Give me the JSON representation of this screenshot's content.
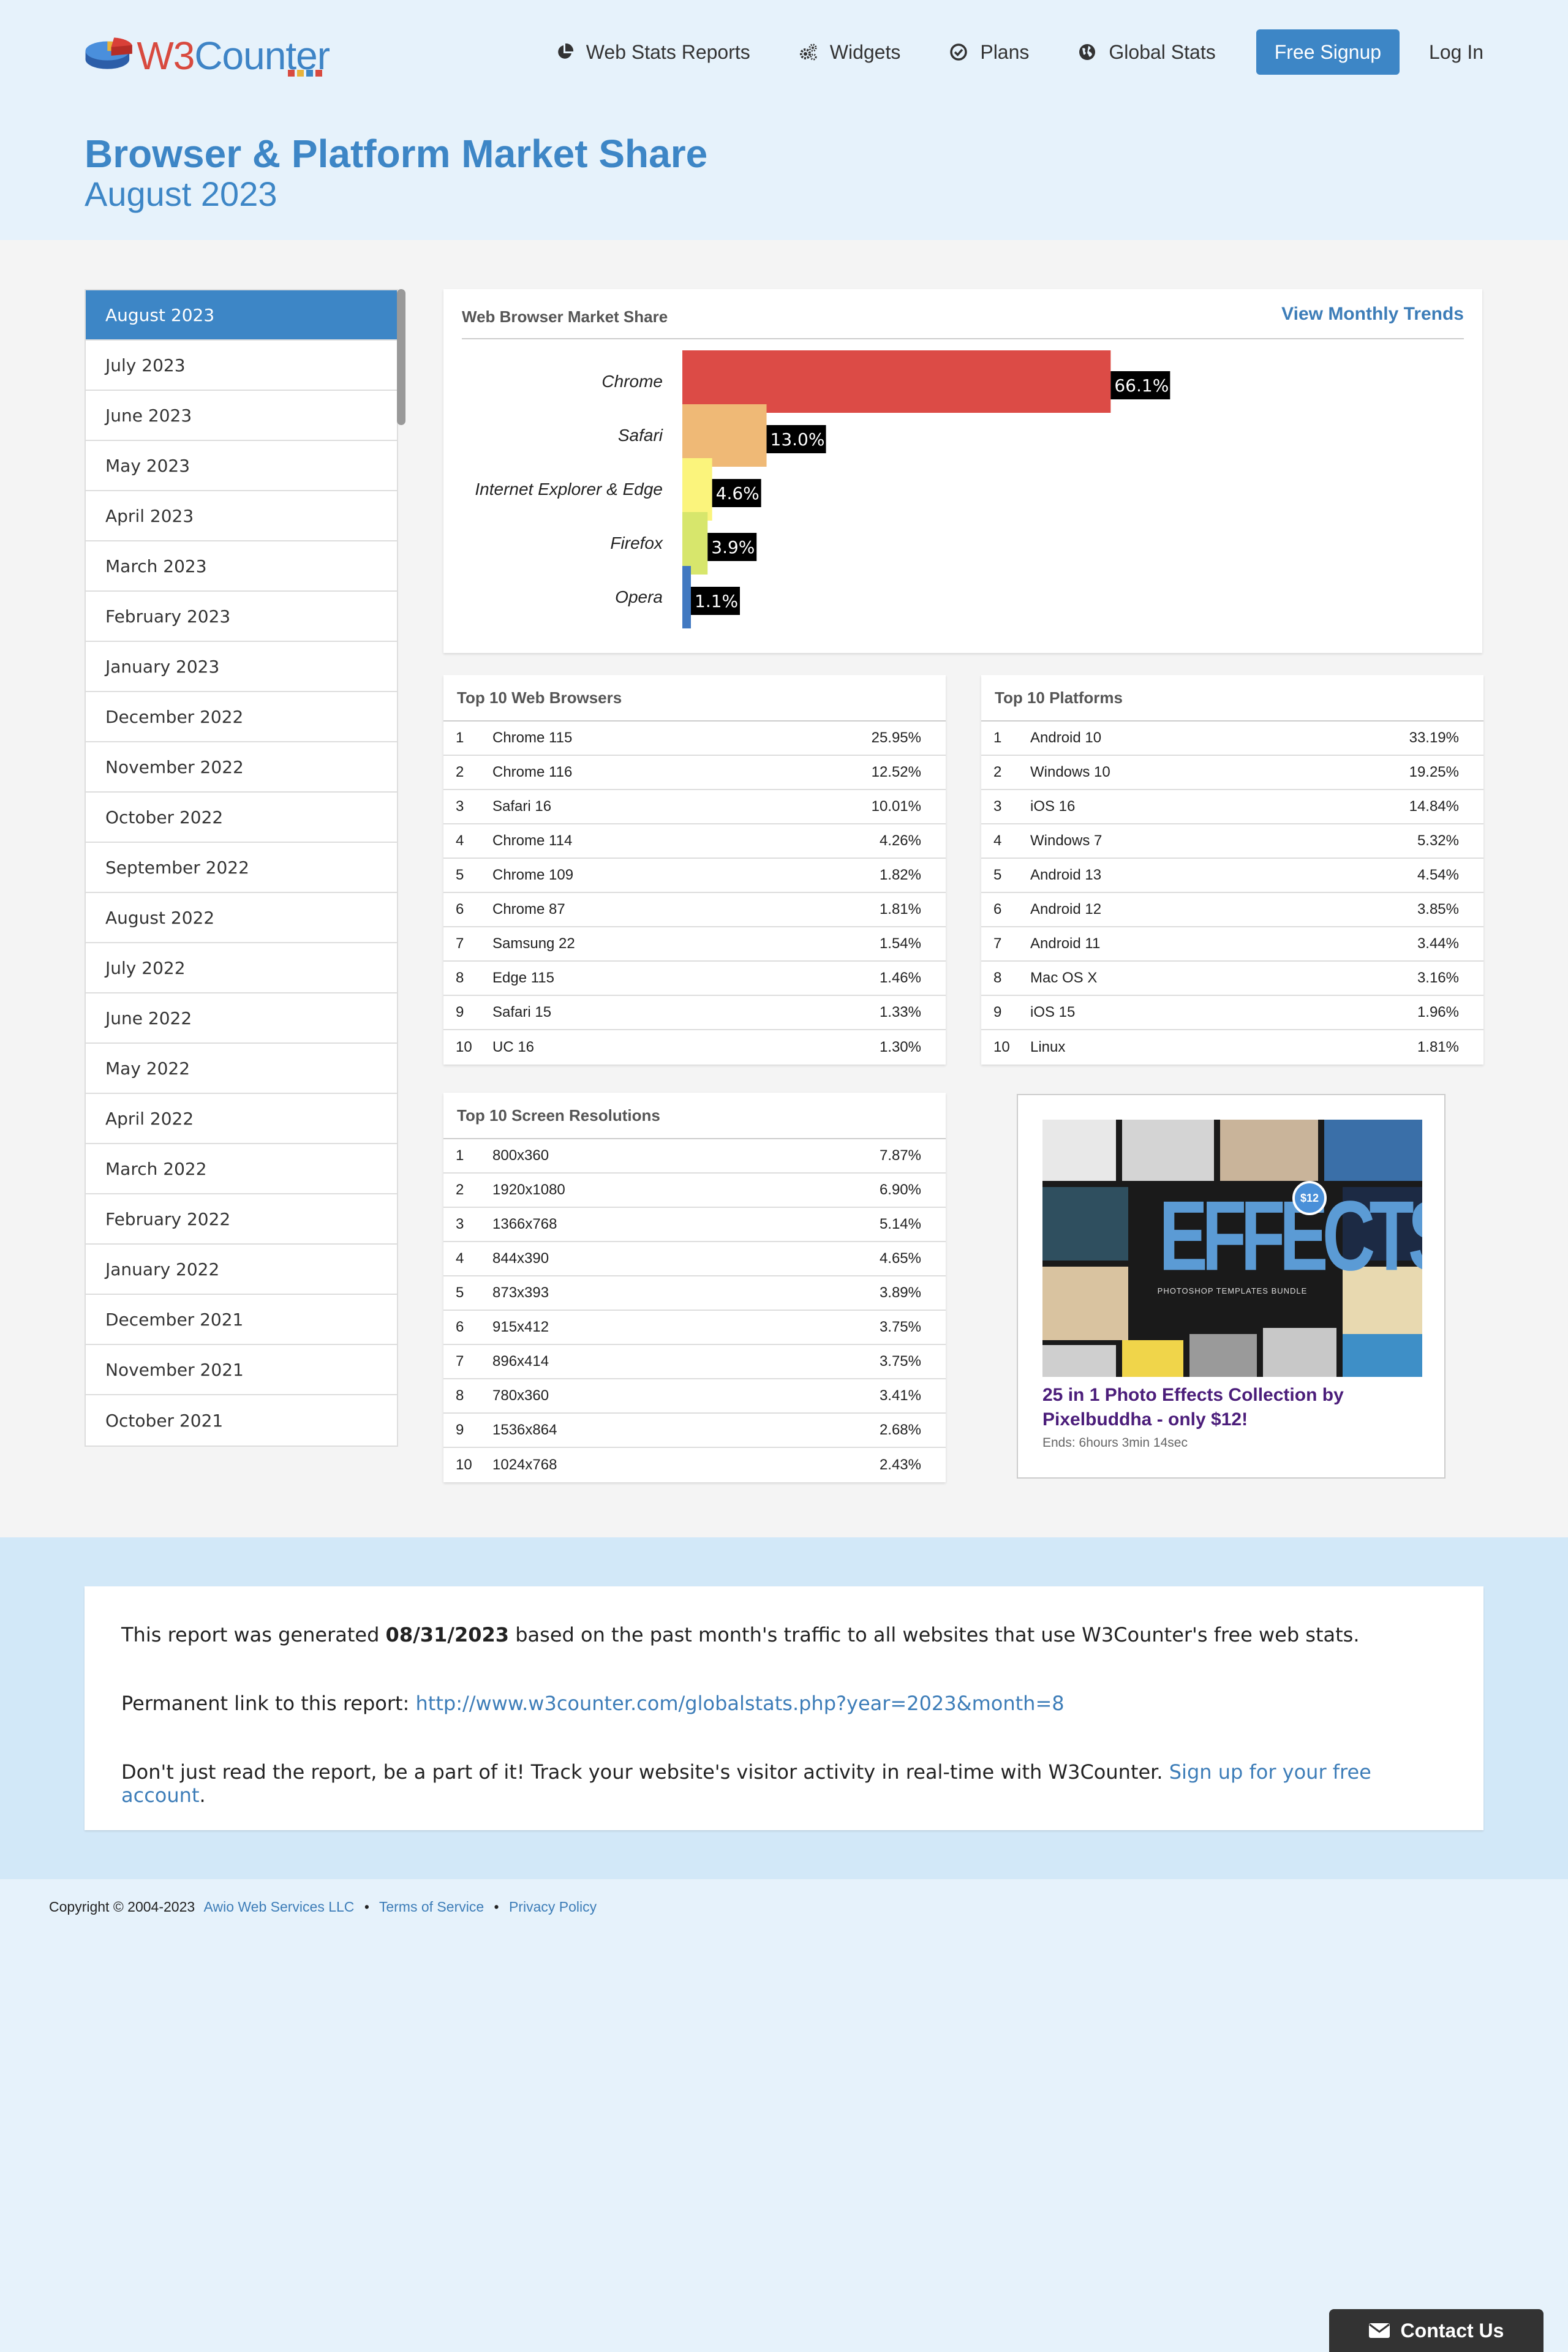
{
  "brand": {
    "logo_text_w3": "W3",
    "logo_text_counter": "Counter",
    "colors": {
      "primary": "#3d86c6",
      "link": "#3d7db8",
      "accent_red": "#d84a3f"
    }
  },
  "nav": {
    "items": [
      {
        "label": "Web Stats Reports",
        "icon": "pie-chart-icon"
      },
      {
        "label": "Widgets",
        "icon": "gears-icon"
      },
      {
        "label": "Plans",
        "icon": "check-circle-icon"
      },
      {
        "label": "Global Stats",
        "icon": "globe-icon"
      }
    ],
    "signup_label": "Free Signup",
    "login_label": "Log In"
  },
  "page": {
    "title": "Browser & Platform Market Share",
    "subtitle": "August 2023"
  },
  "sidebar": {
    "months": [
      "August 2023",
      "July 2023",
      "June 2023",
      "May 2023",
      "April 2023",
      "March 2023",
      "February 2023",
      "January 2023",
      "December 2022",
      "November 2022",
      "October 2022",
      "September 2022",
      "August 2022",
      "July 2022",
      "June 2022",
      "May 2022",
      "April 2022",
      "March 2022",
      "February 2022",
      "January 2022",
      "December 2021",
      "November 2021",
      "October 2021"
    ],
    "active_index": 0
  },
  "chart_panel": {
    "title": "Web Browser Market Share",
    "trends_link": "View Monthly Trends"
  },
  "chart_data": {
    "type": "bar",
    "orientation": "horizontal",
    "title": "Web Browser Market Share",
    "categories": [
      "Chrome",
      "Safari",
      "Internet Explorer & Edge",
      "Firefox",
      "Opera"
    ],
    "values": [
      66.1,
      13.0,
      4.6,
      3.9,
      1.1
    ],
    "labels": [
      "66.1%",
      "13.0%",
      "4.6%",
      "3.9%",
      "1.1%"
    ],
    "colors": [
      "#dc4b46",
      "#efb976",
      "#fbf47c",
      "#d7e66c",
      "#4179c1"
    ],
    "xlim": [
      0,
      100
    ],
    "grid": false
  },
  "top_browsers": {
    "title": "Top 10 Web Browsers",
    "rows": [
      {
        "rank": "1",
        "name": "Chrome 115",
        "value": "25.95%"
      },
      {
        "rank": "2",
        "name": "Chrome 116",
        "value": "12.52%"
      },
      {
        "rank": "3",
        "name": "Safari 16",
        "value": "10.01%"
      },
      {
        "rank": "4",
        "name": "Chrome 114",
        "value": "4.26%"
      },
      {
        "rank": "5",
        "name": "Chrome 109",
        "value": "1.82%"
      },
      {
        "rank": "6",
        "name": "Chrome 87",
        "value": "1.81%"
      },
      {
        "rank": "7",
        "name": "Samsung 22",
        "value": "1.54%"
      },
      {
        "rank": "8",
        "name": "Edge 115",
        "value": "1.46%"
      },
      {
        "rank": "9",
        "name": "Safari 15",
        "value": "1.33%"
      },
      {
        "rank": "10",
        "name": "UC 16",
        "value": "1.30%"
      }
    ]
  },
  "top_platforms": {
    "title": "Top 10 Platforms",
    "rows": [
      {
        "rank": "1",
        "name": "Android 10",
        "value": "33.19%"
      },
      {
        "rank": "2",
        "name": "Windows 10",
        "value": "19.25%"
      },
      {
        "rank": "3",
        "name": "iOS 16",
        "value": "14.84%"
      },
      {
        "rank": "4",
        "name": "Windows 7",
        "value": "5.32%"
      },
      {
        "rank": "5",
        "name": "Android 13",
        "value": "4.54%"
      },
      {
        "rank": "6",
        "name": "Android 12",
        "value": "3.85%"
      },
      {
        "rank": "7",
        "name": "Android 11",
        "value": "3.44%"
      },
      {
        "rank": "8",
        "name": "Mac OS X",
        "value": "3.16%"
      },
      {
        "rank": "9",
        "name": "iOS 15",
        "value": "1.96%"
      },
      {
        "rank": "10",
        "name": "Linux",
        "value": "1.81%"
      }
    ]
  },
  "top_resolutions": {
    "title": "Top 10 Screen Resolutions",
    "rows": [
      {
        "rank": "1",
        "name": "800x360",
        "value": "7.87%"
      },
      {
        "rank": "2",
        "name": "1920x1080",
        "value": "6.90%"
      },
      {
        "rank": "3",
        "name": "1366x768",
        "value": "5.14%"
      },
      {
        "rank": "4",
        "name": "844x390",
        "value": "4.65%"
      },
      {
        "rank": "5",
        "name": "873x393",
        "value": "3.89%"
      },
      {
        "rank": "6",
        "name": "915x412",
        "value": "3.75%"
      },
      {
        "rank": "7",
        "name": "896x414",
        "value": "3.75%"
      },
      {
        "rank": "8",
        "name": "780x360",
        "value": "3.41%"
      },
      {
        "rank": "9",
        "name": "1536x864",
        "value": "2.68%"
      },
      {
        "rank": "10",
        "name": "1024x768",
        "value": "2.43%"
      }
    ]
  },
  "ad": {
    "image_text": "EFFECTS",
    "image_subtext": "PHOTOSHOP TEMPLATES BUNDLE",
    "badge": "$12",
    "title": "25 in 1 Photo Effects Collection by Pixelbuddha - only $12!",
    "meta": "Ends: 6hours  3min  14sec"
  },
  "info": {
    "line1_pre": "This report was generated ",
    "line1_date": "08/31/2023",
    "line1_post": " based on the past month's traffic to all websites that use W3Counter's free web stats.",
    "line2_pre": "Permanent link to this report: ",
    "line2_link": "http://www.w3counter.com/globalstats.php?year=2023&month=8",
    "line3_pre": "Don't just read the report, be a part of it! Track your website's visitor activity in real-time with W3Counter. ",
    "line3_link": "Sign up for your free account",
    "line3_post": "."
  },
  "footer": {
    "copyright": "Copyright © 2004-2023",
    "company": "Awio Web Services LLC",
    "terms": "Terms of Service",
    "privacy": "Privacy Policy",
    "separator": "•"
  },
  "contact": {
    "label": "Contact Us"
  }
}
